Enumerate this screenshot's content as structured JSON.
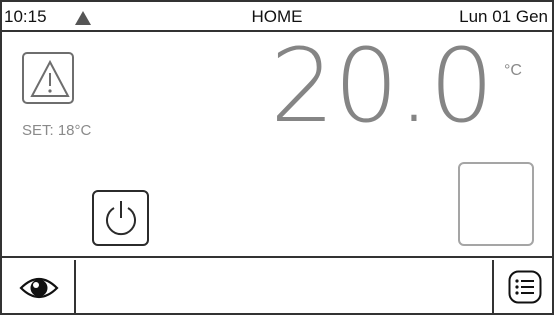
{
  "status_bar": {
    "time": "10:15",
    "alert_icon": "warning-triangle-icon",
    "title": "HOME",
    "date": "Lun 01 Gen"
  },
  "main": {
    "warning_icon": "warning-icon",
    "setpoint_label": "SET: 18°C",
    "temperature": "20.0",
    "unit": "°C",
    "power_icon": "power-icon"
  },
  "bottom_bar": {
    "eye_icon": "eye-icon",
    "message": "",
    "menu_icon": "menu-list-icon"
  },
  "colors": {
    "border": "#333333",
    "temperature_text": "#858585",
    "muted_text": "#8a8a8a",
    "alert_icon": "#555555"
  }
}
